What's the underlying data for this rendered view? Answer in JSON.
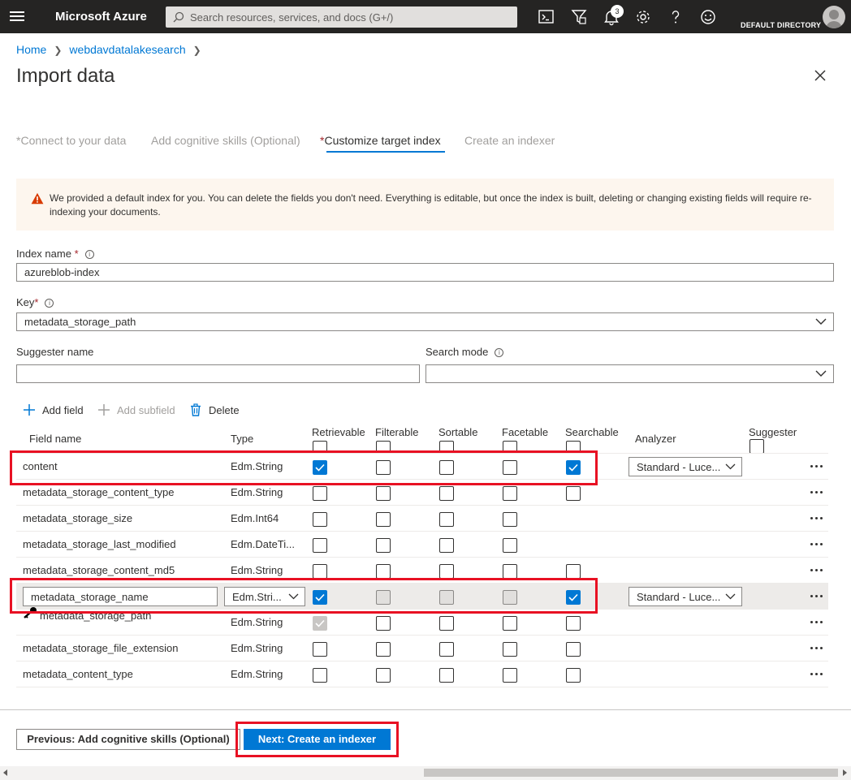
{
  "topbar": {
    "brand": "Microsoft Azure",
    "search_placeholder": "Search resources, services, and docs (G+/)",
    "notifications_count": "3",
    "directory": "DEFAULT DIRECTORY",
    "icons": [
      "hamburger-icon",
      "search-icon",
      "cloud-shell-icon",
      "directory-filter-icon",
      "bell-icon",
      "gear-icon",
      "help-icon",
      "feedback-icon",
      "avatar"
    ]
  },
  "breadcrumb": {
    "home": "Home",
    "resource": "webdavdatalakesearch"
  },
  "title": "Import data",
  "tabs": [
    {
      "star": "*",
      "label": "Connect to your data"
    },
    {
      "star": "",
      "label": "Add cognitive skills (Optional)"
    },
    {
      "star": "*",
      "label": "Customize target index"
    },
    {
      "star": "",
      "label": "Create an indexer"
    }
  ],
  "active_tab": "Customize target index",
  "warning": {
    "text": "We provided a default index for you. You can delete the fields you don't need. Everything is editable, but once the index is built, deleting or changing existing fields will require re-indexing your documents."
  },
  "form": {
    "index_name_label": "Index name",
    "index_name_value": "azureblob-index",
    "key_label": "Key",
    "key_value": "metadata_storage_path",
    "suggester_label": "Suggester name",
    "suggester_value": "",
    "search_mode_label": "Search mode",
    "search_mode_value": "",
    "required_mark": "*",
    "info_glyph": "i"
  },
  "toolbar": {
    "add_field": "Add field",
    "add_subfield": "Add subfield",
    "delete": "Delete"
  },
  "table": {
    "headers": {
      "field_name": "Field name",
      "type": "Type",
      "retrievable": "Retrievable",
      "filterable": "Filterable",
      "sortable": "Sortable",
      "facetable": "Facetable",
      "searchable": "Searchable",
      "analyzer": "Analyzer",
      "suggester": "Suggester"
    },
    "rows": [
      {
        "name": "content",
        "type": "Edm.String",
        "retrievable": true,
        "filterable": false,
        "sortable": false,
        "facetable": false,
        "searchable": true,
        "analyzer": "Standard - Luce...",
        "selected": false,
        "key": false
      },
      {
        "name": "metadata_storage_content_type",
        "type": "Edm.String",
        "retrievable": false,
        "filterable": false,
        "sortable": false,
        "facetable": false,
        "searchable": false,
        "analyzer": "",
        "selected": false,
        "key": false
      },
      {
        "name": "metadata_storage_size",
        "type": "Edm.Int64",
        "retrievable": false,
        "filterable": false,
        "sortable": false,
        "facetable": false,
        "searchable": null,
        "analyzer": "",
        "selected": false,
        "key": false
      },
      {
        "name": "metadata_storage_last_modified",
        "type": "Edm.DateTi...",
        "retrievable": false,
        "filterable": false,
        "sortable": false,
        "facetable": false,
        "searchable": null,
        "analyzer": "",
        "selected": false,
        "key": false
      },
      {
        "name": "metadata_storage_content_md5",
        "type": "Edm.String",
        "retrievable": false,
        "filterable": false,
        "sortable": false,
        "facetable": false,
        "searchable": false,
        "analyzer": "",
        "selected": false,
        "key": false
      },
      {
        "name": "metadata_storage_name",
        "type": "Edm.Stri...",
        "retrievable": true,
        "filterable": false,
        "sortable": false,
        "facetable": false,
        "searchable": true,
        "analyzer": "Standard - Luce...",
        "selected": true,
        "key": false
      },
      {
        "name": "metadata_storage_path",
        "type": "Edm.String",
        "retrievable": true,
        "filterable": false,
        "sortable": false,
        "facetable": false,
        "searchable": false,
        "analyzer": "",
        "selected": false,
        "key": true
      },
      {
        "name": "metadata_storage_file_extension",
        "type": "Edm.String",
        "retrievable": false,
        "filterable": false,
        "sortable": false,
        "facetable": false,
        "searchable": false,
        "analyzer": "",
        "selected": false,
        "key": false
      },
      {
        "name": "metadata_content_type",
        "type": "Edm.String",
        "retrievable": false,
        "filterable": false,
        "sortable": false,
        "facetable": false,
        "searchable": false,
        "analyzer": "",
        "selected": false,
        "key": false
      }
    ]
  },
  "footer": {
    "previous_label": "Previous: Add cognitive skills (Optional)",
    "next_label": "Next: Create an indexer"
  },
  "colors": {
    "accent": "#0078d4",
    "topbar": "#252423",
    "highlight_box": "#e81123",
    "warning_bg": "#fdf6ee",
    "warning_icon": "#d83b01"
  }
}
